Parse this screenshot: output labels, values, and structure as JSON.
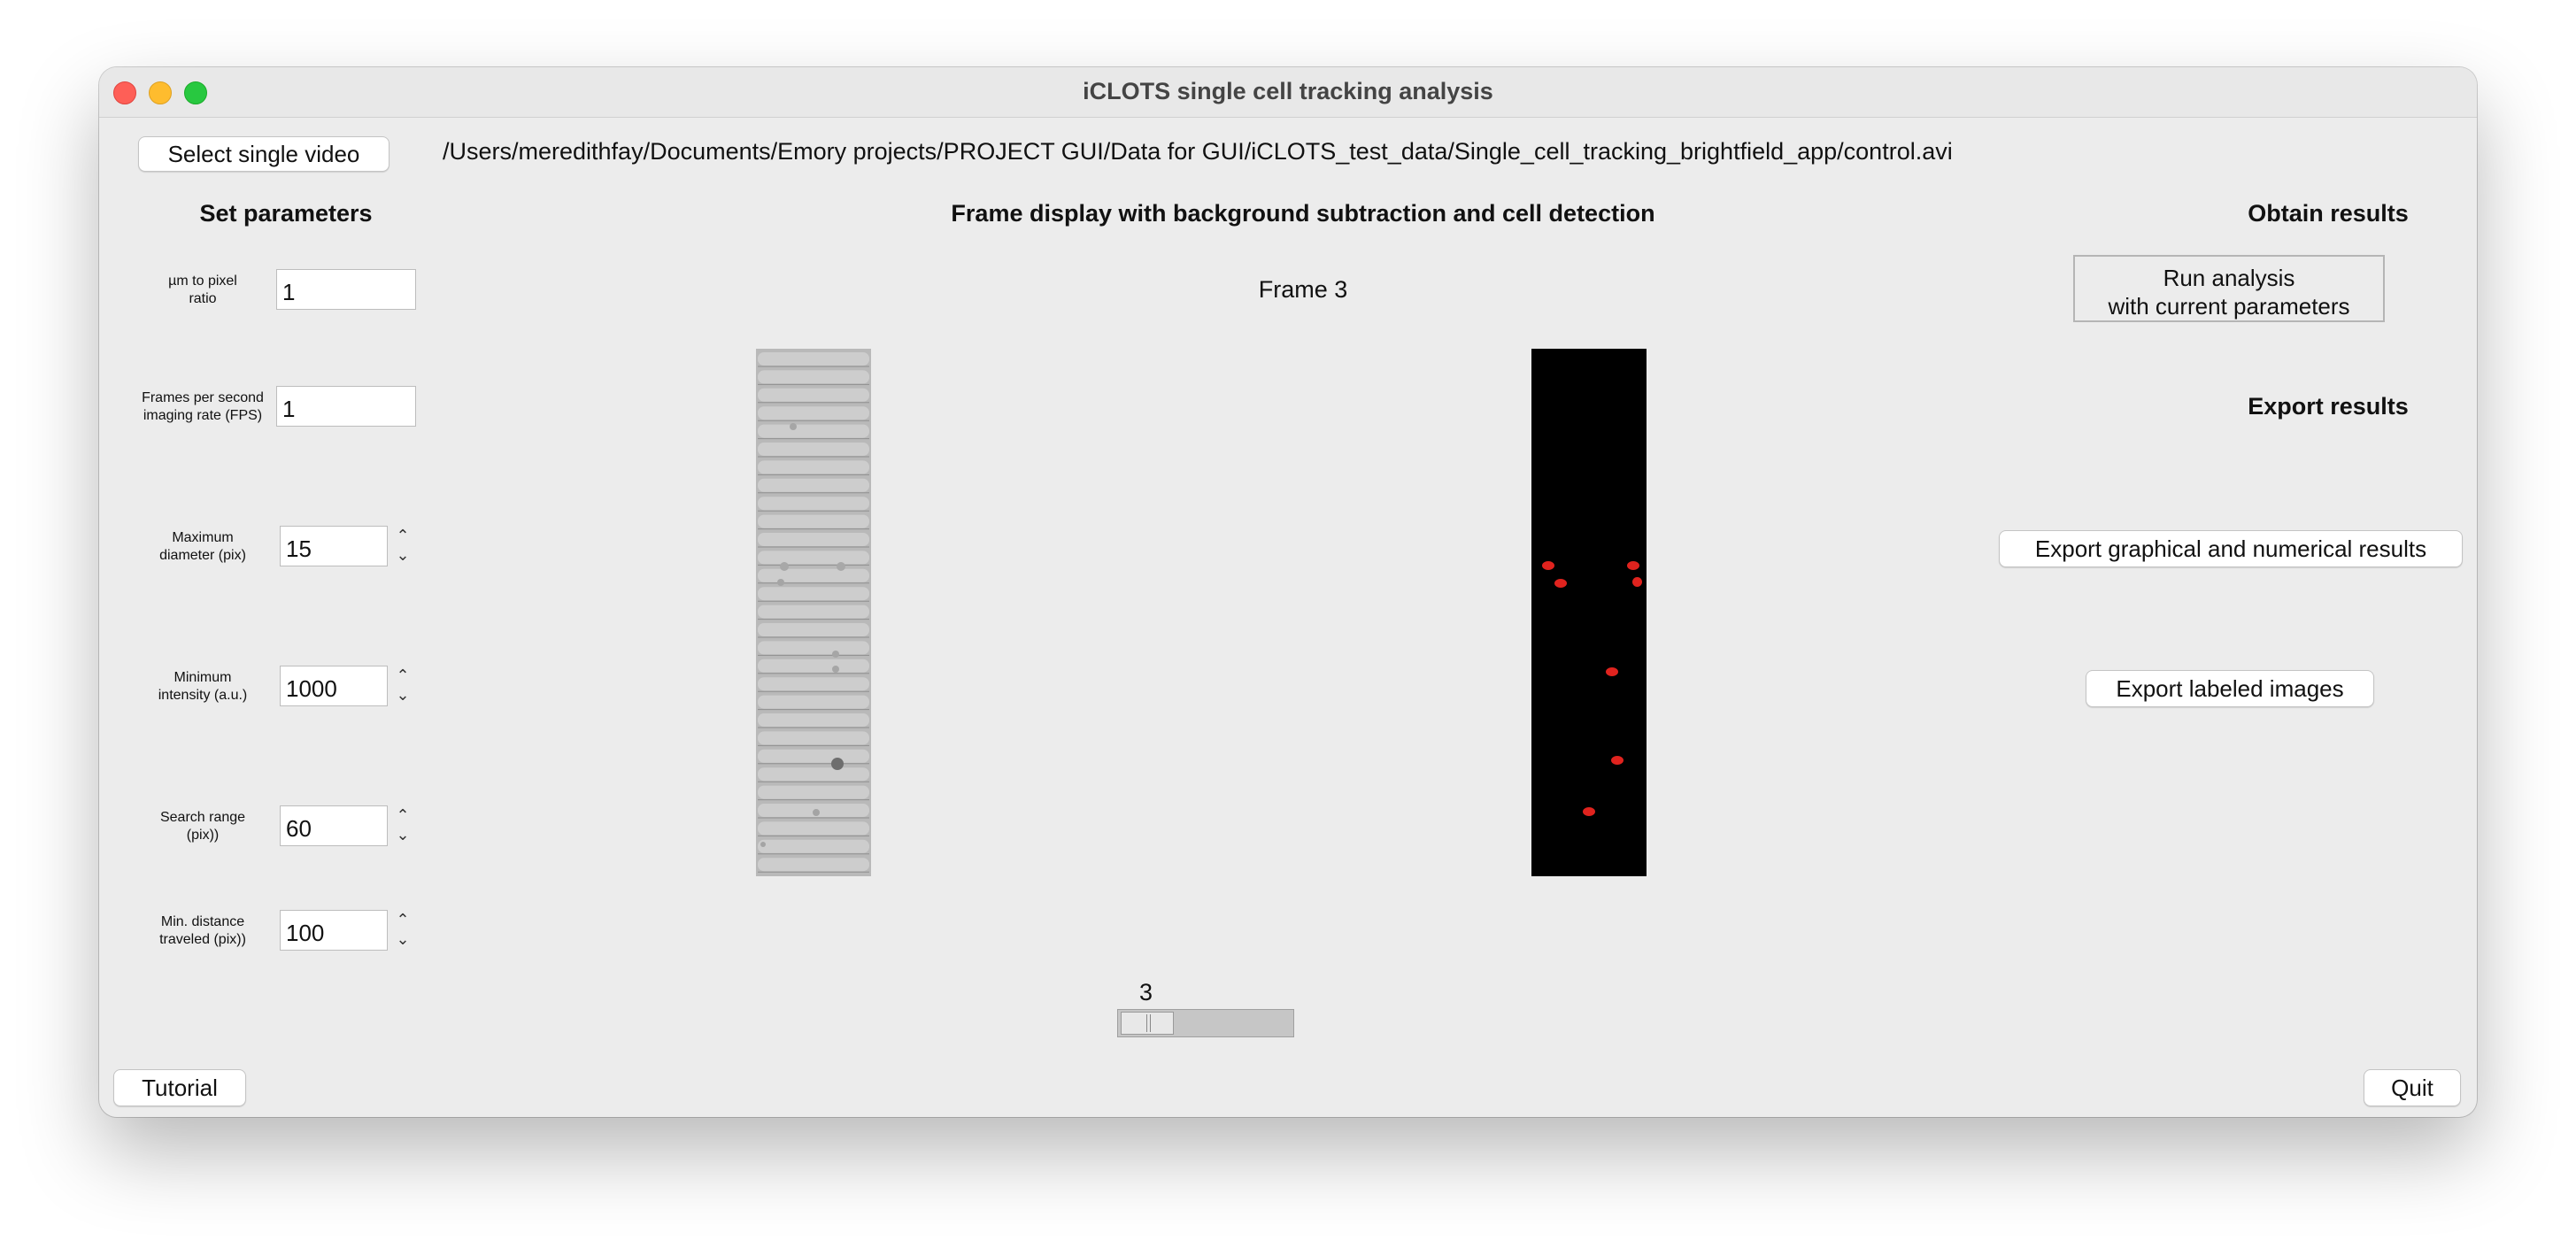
{
  "window": {
    "title": "iCLOTS single cell tracking analysis"
  },
  "file": {
    "select_button": "Select single video",
    "path": "/Users/meredithfay/Documents/Emory projects/PROJECT GUI/Data for GUI/iCLOTS_test_data/Single_cell_tracking_brightfield_app/control.avi"
  },
  "parameters": {
    "heading": "Set parameters",
    "items": [
      {
        "label_1": "µm to pixel",
        "label_2": "ratio",
        "value": "1",
        "stepper": false
      },
      {
        "label_1": "Frames per second",
        "label_2": "imaging rate (FPS)",
        "value": "1",
        "stepper": false
      },
      {
        "label_1": "Maximum",
        "label_2": "diameter (pix)",
        "value": "15",
        "stepper": true
      },
      {
        "label_1": "Minimum",
        "label_2": "intensity (a.u.)",
        "value": "1000",
        "stepper": true
      },
      {
        "label_1": "Search range",
        "label_2": "(pix))",
        "value": "60",
        "stepper": true
      },
      {
        "label_1": "Min. distance",
        "label_2": "traveled (pix))",
        "value": "100",
        "stepper": true
      }
    ]
  },
  "display": {
    "heading": "Frame display with background subtraction and cell detection",
    "frame_label": "Frame 3",
    "slider_value": "3",
    "slider_fraction": 0.05
  },
  "results": {
    "obtain_heading": "Obtain results",
    "run_line1": "Run analysis",
    "run_line2": "with current parameters",
    "export_heading": "Export results",
    "export_all": "Export graphical and numerical results",
    "export_images": "Export labeled images"
  },
  "footer": {
    "tutorial": "Tutorial",
    "quit": "Quit"
  },
  "colors": {
    "detection_marker": "#e0231e",
    "window_bg": "#ececec"
  },
  "icons": [
    "close-window-icon",
    "minimize-window-icon",
    "maximize-window-icon",
    "stepper-arrows-icon"
  ]
}
